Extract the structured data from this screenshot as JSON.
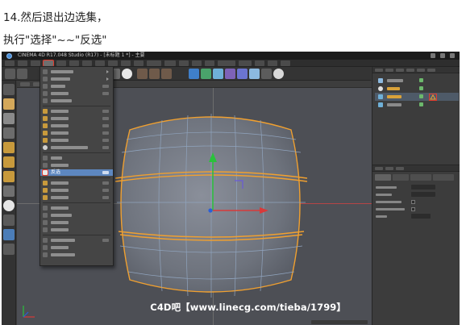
{
  "caption": {
    "line1": "14.然后退出边选集，",
    "line2": "执行\"选择\"~~\"反选\""
  },
  "app": {
    "title": "CINEMA 4D R17.048 Studio (R17) - [未标题 1 *] - 主要",
    "watermark": "C4D吧【www.linecg.com/tieba/1799】"
  },
  "select_menu": {
    "highlighted_label": "反选",
    "highlight_color": "#5d87c0",
    "callout_color": "#e23b2e"
  },
  "viewport": {
    "background": "#4d4f55",
    "wireframe_color": "#90a4be",
    "selected_edge_color": "#f0a030"
  },
  "icons": {
    "app_logo": "cinema4d-logo-icon",
    "y_axis": "green-arrow-icon",
    "x_axis": "red-arrow-icon",
    "origin": "blue-point-icon"
  }
}
